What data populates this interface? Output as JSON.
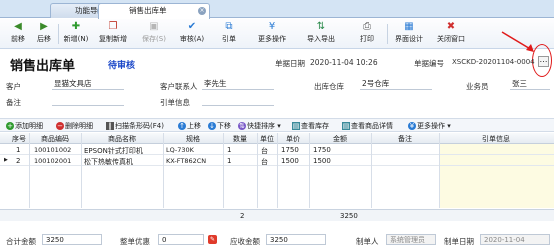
{
  "tabs": [
    {
      "label": "功能导航面"
    },
    {
      "label": "销售出库单"
    }
  ],
  "toolbar": {
    "items": [
      {
        "label": "前移",
        "icon": "arrow-left-icon"
      },
      {
        "label": "后移",
        "icon": "arrow-right-icon"
      },
      {
        "label": "新增(N)",
        "icon": "plus-icon"
      },
      {
        "label": "复制新增",
        "icon": "copy-icon"
      },
      {
        "label": "保存(S)",
        "icon": "save-icon"
      },
      {
        "label": "审核(A)",
        "icon": "check-icon"
      },
      {
        "label": "引单",
        "icon": "link-icon"
      },
      {
        "label": "更多操作",
        "icon": "more-icon"
      },
      {
        "label": "导入导出",
        "icon": "import-export-icon"
      },
      {
        "label": "打印",
        "icon": "print-icon"
      },
      {
        "label": "界面设计",
        "icon": "design-icon"
      },
      {
        "label": "关闭窗口",
        "icon": "close-icon"
      }
    ]
  },
  "header": {
    "title": "销售出库单",
    "status": "待审核",
    "date_label": "单据日期",
    "date_value": "2020-11-04 10:26",
    "no_label": "单据编号",
    "no_value": "XSCKD-20201104-0004"
  },
  "form": {
    "customer_label": "客户",
    "customer_value": "显猫文具店",
    "contact_label": "客户联系人",
    "contact_value": "李先生",
    "warehouse_label": "出库仓库",
    "warehouse_value": "2号仓库",
    "salesman_label": "业务员",
    "salesman_value": "张三",
    "remark_label": "备注",
    "remark_value": "",
    "ref_label": "引单信息",
    "ref_value": ""
  },
  "grid_toolbar": [
    {
      "label": "添加明细"
    },
    {
      "label": "删除明细"
    },
    {
      "label": "扫描条形码(F4)"
    },
    {
      "label": "上移"
    },
    {
      "label": "下移"
    },
    {
      "label": "快捷排序"
    },
    {
      "label": "查看库存"
    },
    {
      "label": "查看商品详情"
    },
    {
      "label": "更多操作"
    }
  ],
  "grid": {
    "columns": [
      "序号",
      "商品编码",
      "商品名称",
      "规格",
      "数量",
      "单位",
      "单价",
      "金额",
      "备注",
      "引单信息"
    ],
    "rows": [
      {
        "seq": "1",
        "code": "100101002",
        "name": "EPSON针式打印机",
        "spec": "LQ-730K",
        "qty": "1",
        "unit": "台",
        "price": "1750",
        "amount": "1750",
        "note": "",
        "ref": ""
      },
      {
        "seq": "2",
        "code": "100102001",
        "name": "松下热敏传真机",
        "spec": "KX-FT862CN",
        "qty": "1",
        "unit": "台",
        "price": "1500",
        "amount": "1500",
        "note": "",
        "ref": ""
      }
    ],
    "footer_qty": "2",
    "footer_amount": "3250"
  },
  "bottom": {
    "total_label": "合计金额",
    "total_value": "3250",
    "discount_label": "整单优惠",
    "discount_value": "0",
    "receivable_label": "应收金额",
    "receivable_value": "3250",
    "maker_label": "制单人",
    "maker_value": "系统管理员",
    "make_date_label": "制单日期",
    "make_date_value": "2020-11-04"
  },
  "colors": {
    "accent": "#1a47c8",
    "highlight": "#e01a1a"
  }
}
